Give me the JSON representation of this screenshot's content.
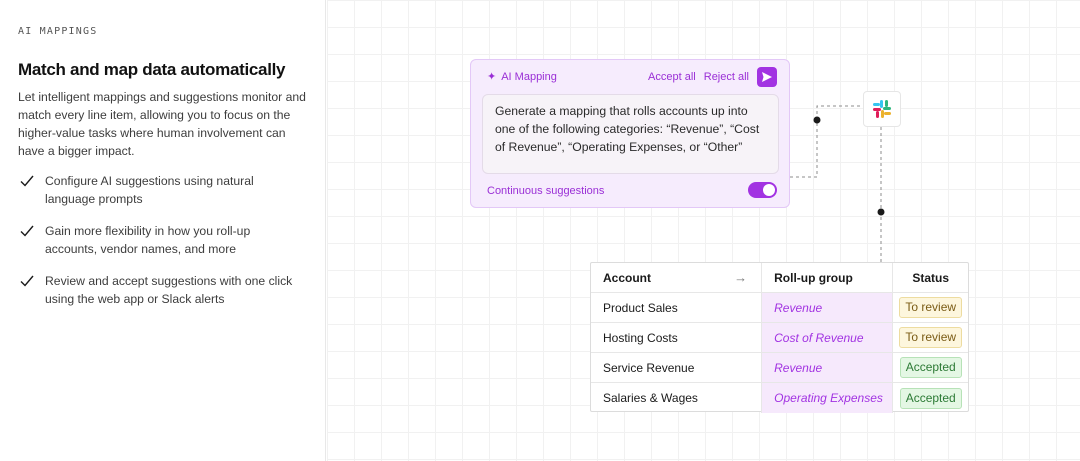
{
  "left": {
    "eyebrow": "AI MAPPINGS",
    "title": "Match and map data automatically",
    "description": "Let intelligent mappings and suggestions monitor and match every line item, allowing you to focus on the higher-value tasks where human involvement can have a bigger impact.",
    "features": [
      "Configure AI suggestions using natural language prompts",
      "Gain more flexibility in how you roll-up accounts, vendor names, and more",
      "Review and accept suggestions with one click using the web app or Slack alerts"
    ]
  },
  "ai_card": {
    "title": "AI Mapping",
    "accept_all": "Accept all",
    "reject_all": "Reject all",
    "prompt": "Generate a mapping that rolls accounts up into one of the following categories: “Revenue”, “Cost of Revenue”, “Operating Expenses, or “Other”",
    "footer_label": "Continuous suggestions",
    "toggle_on": true,
    "send_icon": "send-icon",
    "accent_color": "#a233e2"
  },
  "integration": {
    "icon": "slack-icon"
  },
  "table": {
    "headers": {
      "account": "Account",
      "arrow": "→",
      "rollup": "Roll-up group",
      "status": "Status"
    },
    "rows": [
      {
        "account": "Product Sales",
        "rollup": "Revenue",
        "status": "To review",
        "status_kind": "review"
      },
      {
        "account": "Hosting Costs",
        "rollup": "Cost of Revenue",
        "status": "To review",
        "status_kind": "review"
      },
      {
        "account": "Service Revenue",
        "rollup": "Revenue",
        "status": "Accepted",
        "status_kind": "accepted"
      },
      {
        "account": "Salaries & Wages",
        "rollup": "Operating Expenses",
        "status": "Accepted",
        "status_kind": "accepted"
      }
    ],
    "colors": {
      "review": "#fdf6dd",
      "accepted": "#e4f7e4"
    }
  }
}
